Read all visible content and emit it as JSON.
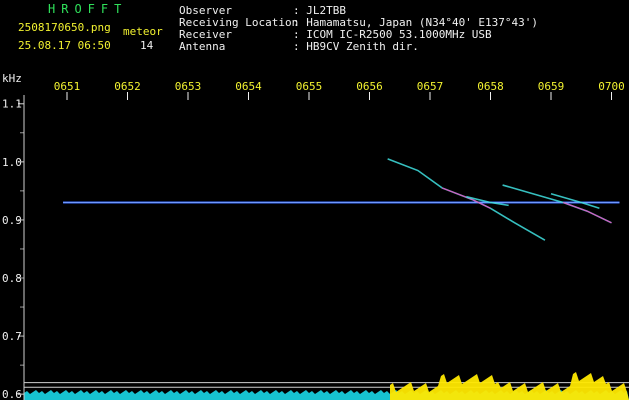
{
  "header": {
    "title": "HROFFT",
    "filename": "2508170650.png",
    "datetime": "25.08.17 06:50",
    "meteor_label": "meteor",
    "meteor_count": "14",
    "info": [
      {
        "label": "Observer",
        "value": ": JL2TBB"
      },
      {
        "label": "Receiving Location",
        "value": ": Hamamatsu, Japan (N34°40' E137°43')"
      },
      {
        "label": "Receiver",
        "value": ": ICOM IC-R2500 53.1000MHz USB"
      },
      {
        "label": "Antenna",
        "value": ": HB9CV Zenith dir."
      }
    ]
  },
  "colors": {
    "label_yellow": "#f2f230",
    "text_white": "#f0f0f0",
    "title_green": "#2fe05a",
    "carrier_blue": "#3a6cff",
    "trail_cyan": "#40e0e0",
    "trail_magenta": "#ff40c0",
    "noise_cyan": "#19d8e8",
    "meteor_yellow": "#ffe800"
  },
  "chart_data": {
    "type": "spectrogram",
    "yunit": "kHz",
    "x_ticks": [
      "0651",
      "0652",
      "0653",
      "0654",
      "0655",
      "0656",
      "0657",
      "0658",
      "0659",
      "0700"
    ],
    "y_ticks": [
      "1.1",
      "1.0",
      "0.9",
      "0.8",
      "0.7",
      "0.6"
    ],
    "y_tick_values": [
      1.1,
      1.0,
      0.9,
      0.8,
      0.7,
      0.6
    ],
    "xlim_minutes": [
      0.7,
      10.0
    ],
    "ylim_khz": [
      0.59,
      1.115
    ],
    "carrier": {
      "freq_khz": 0.93,
      "x_start_min": 1.1,
      "x_end_min": 10.0
    },
    "meteor_trails": [
      {
        "points": [
          [
            6.3,
            1.005
          ],
          [
            6.8,
            0.985
          ],
          [
            7.2,
            0.955
          ],
          [
            7.7,
            0.935
          ],
          [
            8.0,
            0.92
          ],
          [
            8.4,
            0.895
          ],
          [
            8.9,
            0.865
          ]
        ]
      },
      {
        "points": [
          [
            7.6,
            0.94
          ],
          [
            8.0,
            0.93
          ],
          [
            8.3,
            0.925
          ]
        ]
      },
      {
        "points": [
          [
            8.2,
            0.96
          ],
          [
            8.7,
            0.945
          ],
          [
            9.2,
            0.93
          ],
          [
            9.6,
            0.915
          ],
          [
            10.0,
            0.895
          ]
        ]
      },
      {
        "points": [
          [
            9.0,
            0.945
          ],
          [
            9.5,
            0.93
          ],
          [
            9.8,
            0.92
          ]
        ]
      }
    ],
    "noise_floor": {
      "level_khz": 0.605,
      "lines_khz": [
        0.62,
        0.612
      ]
    }
  }
}
